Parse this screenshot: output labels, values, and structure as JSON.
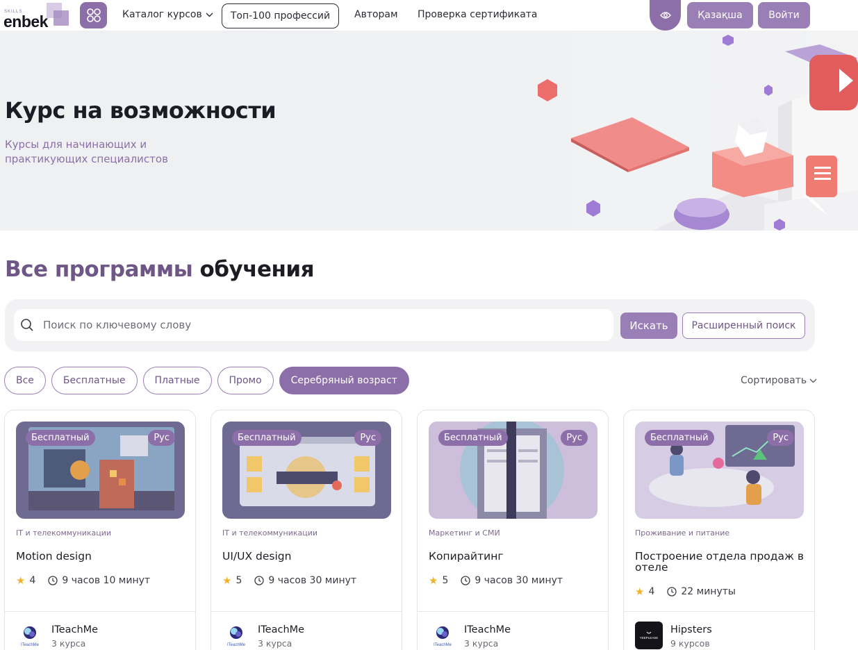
{
  "header": {
    "logo_small": "SKILLS",
    "logo_main": "enbek",
    "catalog_label": "Каталог курсов",
    "top100_label": "Топ-100 профессий",
    "authors_label": "Авторам",
    "cert_label": "Проверка сертификата",
    "lang_label": "Қазақша",
    "login_label": "Войти"
  },
  "hero": {
    "title": "Курс на возможности",
    "subtitle": "Курсы для начинающих и практикующих специалистов"
  },
  "section": {
    "title_accent": "Все программы",
    "title_rest": "обучения"
  },
  "search": {
    "placeholder": "Поиск по ключевому слову",
    "value": "",
    "submit_label": "Искать",
    "advanced_label": "Расширенный поиск"
  },
  "filters": {
    "items": [
      "Все",
      "Бесплатные",
      "Платные",
      "Промо",
      "Серебряный возраст"
    ],
    "active": "Серебряный возраст",
    "sort_label": "Сортировать"
  },
  "cards": [
    {
      "badge_price": "Бесплатный",
      "badge_lang": "Рус",
      "category": "IT и телекоммуникации",
      "title": "Motion design",
      "rating": "4",
      "duration": "9 часов 10 минут",
      "author": "ITeachMe",
      "author_count": "3 курса",
      "author_logo_text": "ITeachMe"
    },
    {
      "badge_price": "Бесплатный",
      "badge_lang": "Рус",
      "category": "IT и телекоммуникации",
      "title": "UI/UX design",
      "rating": "5",
      "duration": "9 часов 30 минут",
      "author": "ITeachMe",
      "author_count": "3 курса",
      "author_logo_text": "ITeachMe"
    },
    {
      "badge_price": "Бесплатный",
      "badge_lang": "Рус",
      "category": "Маркетинг и СМИ",
      "title": "Копирайтинг",
      "rating": "5",
      "duration": "9 часов 30 минут",
      "author": "ITeachMe",
      "author_count": "3 курса",
      "author_logo_text": "ITeachMe"
    },
    {
      "badge_price": "Бесплатный",
      "badge_lang": "Рус",
      "category": "Проживание и питание",
      "title": "Построение отдела продаж в отеле",
      "rating": "4",
      "duration": "22 минуты",
      "author": "Hipsters",
      "author_count": "9 курсов",
      "author_logo_text": "YEEPLEASE"
    }
  ],
  "colors": {
    "accent": "#8c6fa8",
    "accent_dark": "#6e5686",
    "star": "#f2b32b"
  }
}
